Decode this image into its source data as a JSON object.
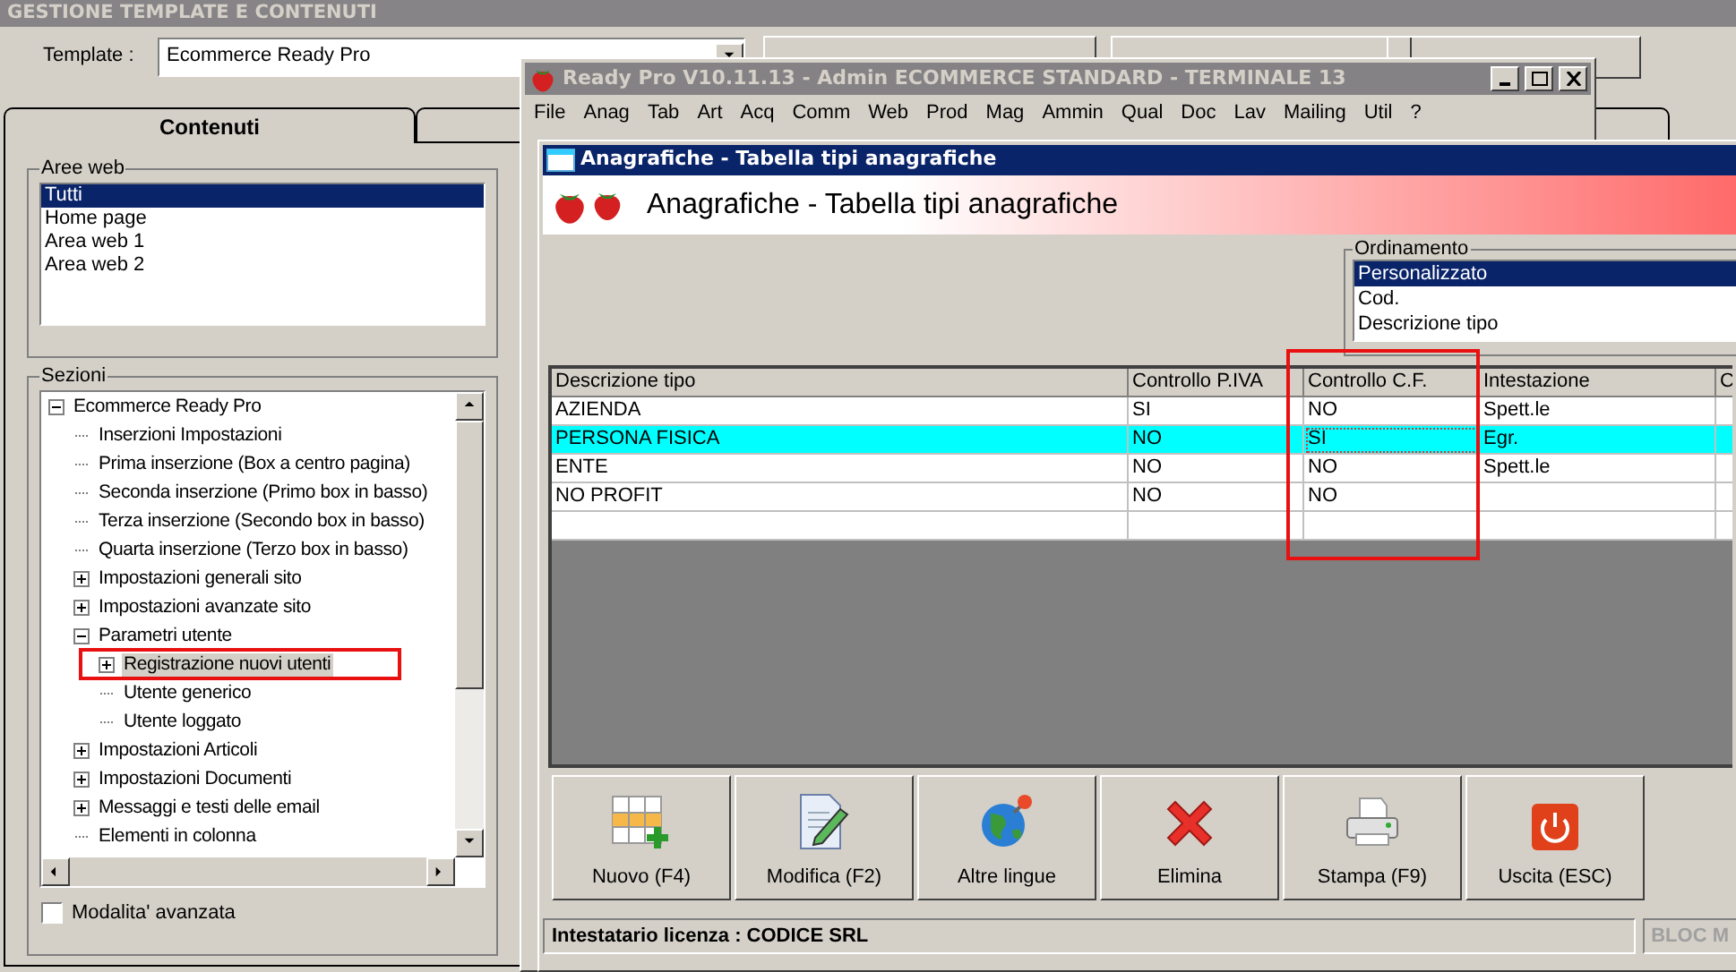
{
  "back_window": {
    "title": "GESTIONE TEMPLATE E CONTENUTI",
    "template": {
      "label": "Template :",
      "value": "Ecommerce Ready Pro"
    },
    "tabs": [
      {
        "label": "Contenuti",
        "selected": true
      },
      {
        "selected": false
      }
    ],
    "aree_web": {
      "title": "Aree web",
      "items": [
        {
          "label": "Tutti",
          "selected": true
        },
        {
          "label": "Home page",
          "selected": false
        },
        {
          "label": "Area web 1",
          "selected": false
        },
        {
          "label": "Area web 2",
          "selected": false
        }
      ]
    },
    "sezioni": {
      "title": "Sezioni",
      "tree": [
        {
          "label": "Ecommerce Ready Pro",
          "expanded": true,
          "selected": false,
          "children": [
            {
              "label": "Inserzioni Impostazioni",
              "selected": false
            },
            {
              "label": "Prima inserzione (Box a centro pagina)",
              "selected": false
            },
            {
              "label": "Seconda inserzione (Primo box in basso)",
              "selected": false
            },
            {
              "label": "Terza inserzione (Secondo box in basso)",
              "selected": false
            },
            {
              "label": "Quarta inserzione (Terzo box in basso)",
              "selected": false
            },
            {
              "label": "Impostazioni generali sito",
              "expanded": false,
              "selected": false
            },
            {
              "label": "Impostazioni avanzate sito",
              "expanded": false,
              "selected": false
            },
            {
              "label": "Parametri utente",
              "expanded": true,
              "selected": false,
              "children": [
                {
                  "label": "Registrazione nuovi utenti",
                  "expanded": false,
                  "selected": true
                },
                {
                  "label": "Utente generico",
                  "selected": false
                },
                {
                  "label": "Utente loggato",
                  "selected": false
                }
              ]
            },
            {
              "label": "Impostazioni Articoli",
              "expanded": false,
              "selected": false
            },
            {
              "label": "Impostazioni Documenti",
              "expanded": false,
              "selected": false
            },
            {
              "label": "Messaggi e testi delle email",
              "expanded": false,
              "selected": false
            },
            {
              "label": "Elementi in colonna",
              "selected": false
            }
          ]
        }
      ]
    },
    "advanced_mode": {
      "label": "Modalita' avanzata",
      "checked": false
    }
  },
  "app_window": {
    "title": "Ready Pro V10.11.13 - Admin ECOMMERCE STANDARD - TERMINALE 13",
    "menu": [
      "File",
      "Anag",
      "Tab",
      "Art",
      "Acq",
      "Comm",
      "Web",
      "Prod",
      "Mag",
      "Ammin",
      "Qual",
      "Doc",
      "Lav",
      "Mailing",
      "Util",
      "?"
    ]
  },
  "child_window": {
    "title": "Anagrafiche - Tabella tipi anagrafiche",
    "header": "Anagrafiche - Tabella tipi anagrafiche",
    "sorting": {
      "title": "Ordinamento",
      "items": [
        {
          "label": "Personalizzato",
          "selected": true
        },
        {
          "label": "Cod.",
          "selected": false
        },
        {
          "label": "Descrizione tipo",
          "selected": false
        }
      ]
    },
    "table": {
      "columns": [
        "Descrizione tipo",
        "Controllo P.IVA",
        "Controllo C.F.",
        "Intestazione",
        "C"
      ],
      "rows": [
        {
          "cells": [
            "AZIENDA",
            "SI",
            "NO",
            "Spett.le",
            ""
          ],
          "selected": false
        },
        {
          "cells": [
            "PERSONA FISICA",
            "NO",
            "SI",
            "Egr.",
            ""
          ],
          "selected": true
        },
        {
          "cells": [
            "ENTE",
            "NO",
            "NO",
            "Spett.le",
            ""
          ],
          "selected": false
        },
        {
          "cells": [
            "NO PROFIT",
            "NO",
            "NO",
            "",
            ""
          ],
          "selected": false
        }
      ]
    },
    "buttons": [
      {
        "label": "Nuovo (F4)",
        "kind": "new"
      },
      {
        "label": "Modifica (F2)",
        "kind": "edit"
      },
      {
        "label": "Altre lingue",
        "kind": "languages"
      },
      {
        "label": "Elimina",
        "kind": "delete"
      },
      {
        "label": "Stampa (F9)",
        "kind": "print"
      },
      {
        "label": "Uscita (ESC)",
        "kind": "exit"
      }
    ],
    "status": {
      "license": "Intestatario licenza : CODICE SRL",
      "indicator": "BLOC M"
    }
  }
}
